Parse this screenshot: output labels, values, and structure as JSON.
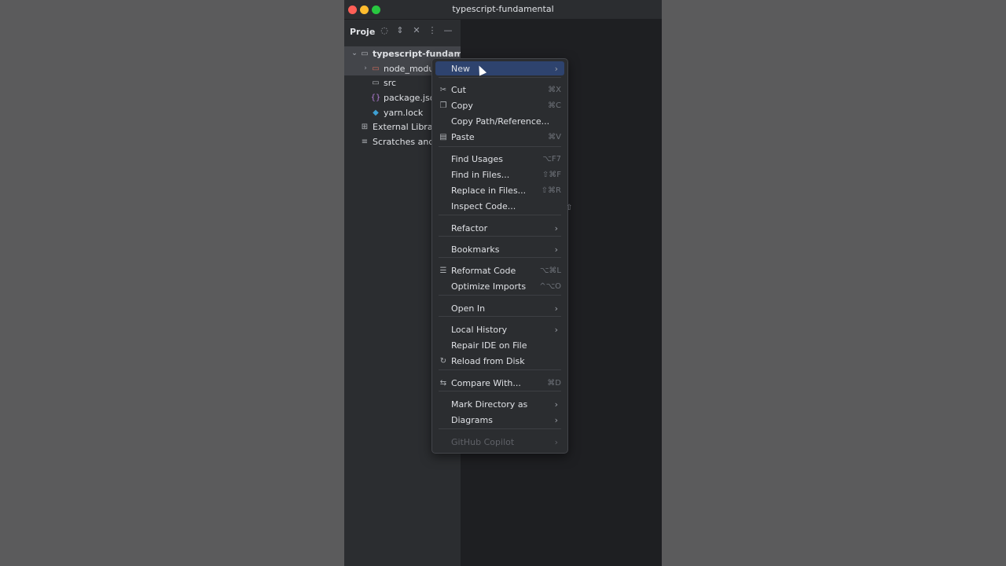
{
  "window": {
    "title": "typescript-fundamental"
  },
  "panel": {
    "title": "Proje",
    "icons": [
      "target-icon",
      "expand-icon",
      "collapse-icon",
      "more-icon",
      "minimize-icon"
    ]
  },
  "tree": [
    {
      "label": "typescript-fundament",
      "icon": "folder-icon",
      "chevron": "⌄",
      "indent": 1,
      "root": true,
      "selected": true
    },
    {
      "label": "node_modul",
      "icon": "folder-red-icon",
      "chevron": "›",
      "indent": 2,
      "selected": true
    },
    {
      "label": "src",
      "icon": "folder-icon",
      "chevron": "",
      "indent": 2
    },
    {
      "label": "package.jso",
      "icon": "json-icon",
      "chevron": "",
      "indent": 2
    },
    {
      "label": "yarn.lock",
      "icon": "yarn-icon",
      "chevron": "",
      "indent": 2
    },
    {
      "label": "External Librari",
      "icon": "library-icon",
      "chevron": "",
      "indent": 1
    },
    {
      "label": "Scratches and",
      "icon": "scratch-icon",
      "chevron": "",
      "indent": 1
    }
  ],
  "menu": {
    "items": [
      {
        "label": "New",
        "icon": "",
        "shortcut": "",
        "arrow": true,
        "active": true
      },
      {
        "label": "Cut",
        "icon": "scissors-icon",
        "shortcut": "⌘X"
      },
      {
        "label": "Copy",
        "icon": "copy-icon",
        "shortcut": "⌘C"
      },
      {
        "label": "Copy Path/Reference...",
        "icon": "",
        "shortcut": ""
      },
      {
        "label": "Paste",
        "icon": "paste-icon",
        "shortcut": "⌘V"
      },
      {
        "label": "Find Usages",
        "icon": "",
        "shortcut": "⌥F7"
      },
      {
        "label": "Find in Files...",
        "icon": "",
        "shortcut": "⇧⌘F"
      },
      {
        "label": "Replace in Files...",
        "icon": "",
        "shortcut": "⇧⌘R"
      },
      {
        "label": "Inspect Code...",
        "icon": "",
        "shortcut": ""
      },
      {
        "label": "Refactor",
        "icon": "",
        "shortcut": "",
        "arrow": true
      },
      {
        "label": "Bookmarks",
        "icon": "",
        "shortcut": "",
        "arrow": true
      },
      {
        "label": "Reformat Code",
        "icon": "reformat-icon",
        "shortcut": "⌥⌘L"
      },
      {
        "label": "Optimize Imports",
        "icon": "",
        "shortcut": "^⌥O"
      },
      {
        "label": "Open In",
        "icon": "",
        "shortcut": "",
        "arrow": true
      },
      {
        "label": "Local History",
        "icon": "",
        "shortcut": "",
        "arrow": true
      },
      {
        "label": "Repair IDE on File",
        "icon": "",
        "shortcut": ""
      },
      {
        "label": "Reload from Disk",
        "icon": "reload-icon",
        "shortcut": ""
      },
      {
        "label": "Compare With...",
        "icon": "compare-icon",
        "shortcut": "⌘D"
      },
      {
        "label": "Mark Directory as",
        "icon": "",
        "shortcut": "",
        "arrow": true
      },
      {
        "label": "Diagrams",
        "icon": "",
        "shortcut": "",
        "arrow": true
      },
      {
        "label": "GitHub Copilot",
        "icon": "",
        "shortcut": "",
        "arrow": true,
        "disabled": true
      }
    ]
  },
  "colors": {
    "menu_active": "#2e436e",
    "window_bg": "#2b2d30",
    "desktop_bg": "#5b5b5c"
  }
}
